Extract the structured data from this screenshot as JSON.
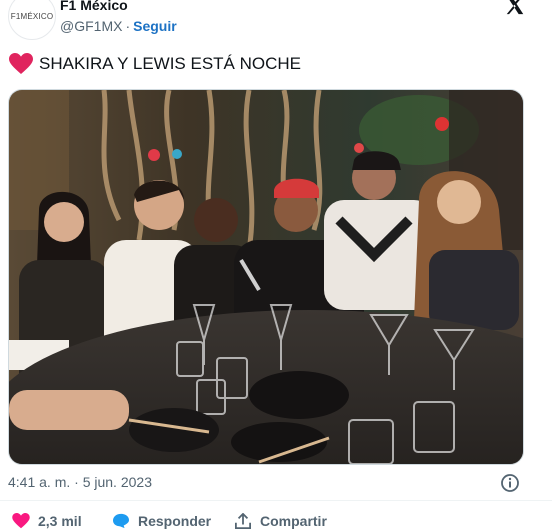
{
  "author": {
    "avatar_text": "F1MÉXICO",
    "name": "F1 México",
    "handle": "@GF1MX",
    "separator": "·",
    "follow_label": "Seguir"
  },
  "tweet": {
    "text": "SHAKIRA Y LEWIS ESTÁ NOCHE",
    "timestamp": "4:41 a. m. · 5 jun. 2023"
  },
  "actions": {
    "likes": "2,3 mil",
    "reply_label": "Responder",
    "share_label": "Compartir"
  },
  "icons": {
    "close": "x-logo-icon",
    "heart_emoji": "red-heart-icon",
    "info": "info-icon",
    "like": "heart-icon",
    "reply": "reply-bubble-icon",
    "share": "share-icon"
  },
  "colors": {
    "accent": "#1d72c4",
    "heart": "#e0245e",
    "like": "#f91880",
    "reply": "#1d9bf0",
    "muted": "#536471"
  }
}
